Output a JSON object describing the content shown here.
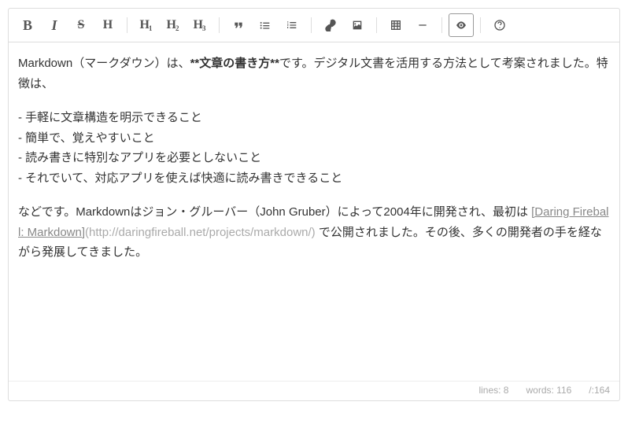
{
  "toolbar": {
    "bold": "B",
    "italic": "I",
    "strike": "S",
    "heading": "H",
    "h1": "H",
    "h1s": "1",
    "h2": "H",
    "h2s": "2",
    "h3": "H",
    "h3s": "3"
  },
  "content": {
    "p1_pre": "Markdown（マークダウン）は、",
    "p1_bold": "**文章の書き方**",
    "p1_post": "です。デジタル文書を活用する方法として考案されました。特徴は、",
    "li1": "- 手軽に文章構造を明示できること",
    "li2": "- 簡単で、覚えやすいこと",
    "li3": "- 読み書きに特別なアプリを必要としないこと",
    "li4": "- それでいて、対応アプリを使えば快適に読み書きできること",
    "p2_pre": "などです。Markdownはジョン・グルーバー（John Gruber）によって2004年に開発され、最初は ",
    "p2_link": "[Daring Fireball: Markdown]",
    "p2_url": "(http://daringfireball.net/projects/markdown/)",
    "p2_post": " で公開されました。その後、多くの開発者の手を経ながら発展してきました。"
  },
  "status": {
    "lines": "lines: 8",
    "words": "words: 116",
    "chars": "/:164"
  }
}
